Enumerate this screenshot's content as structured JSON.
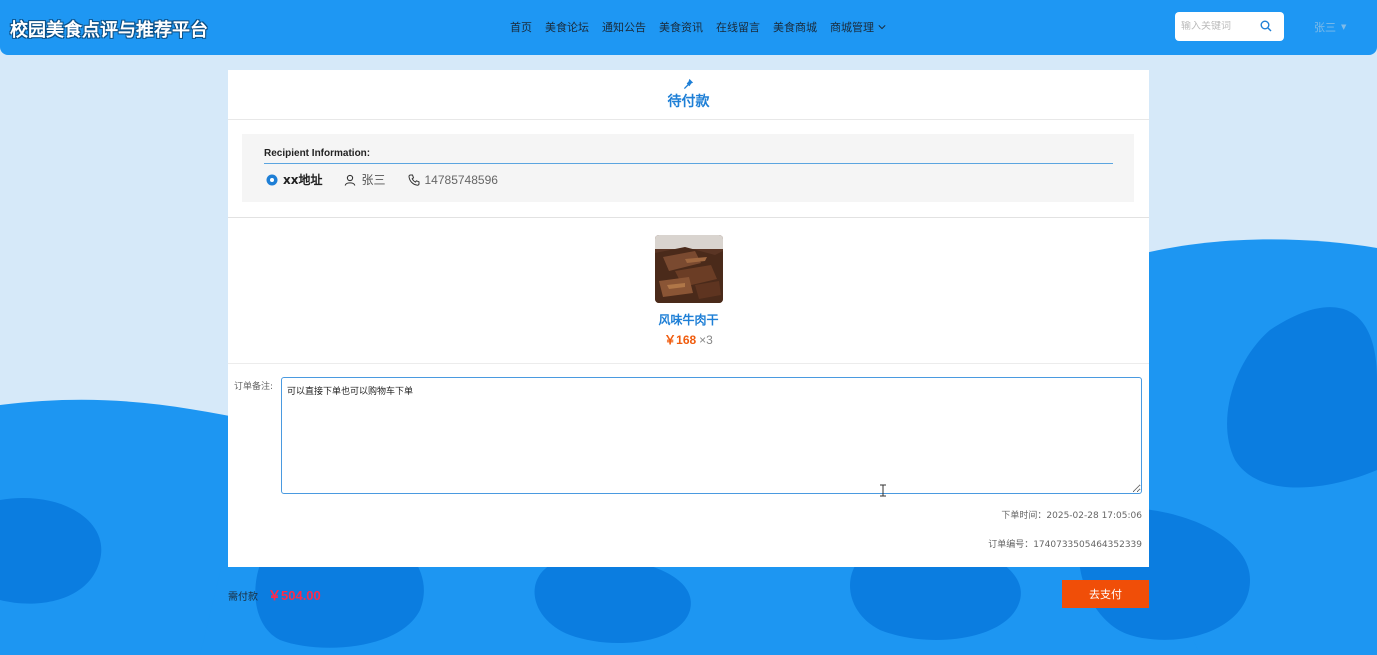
{
  "header": {
    "logo": "校园美食点评与推荐平台",
    "nav": [
      "首页",
      "美食论坛",
      "通知公告",
      "美食资讯",
      "在线留言",
      "美食商城"
    ],
    "nav_dropdown": "商城管理",
    "search_placeholder": "输入关键词",
    "user": "张三"
  },
  "order": {
    "status": "待付款",
    "recipient_label": "Recipient Information:",
    "address": "xx地址",
    "name": "张三",
    "phone": "14785748596",
    "product": {
      "name": "风味牛肉干",
      "price": "￥168",
      "quantity": "×3"
    },
    "remark_label": "订单备注:",
    "remark_value": "可以直接下单也可以购物车下单",
    "order_time": "下单时间：2025-02-28 17:05:06",
    "order_no": "订单编号：1740733505464352339"
  },
  "payment": {
    "label": "需付款",
    "amount": "￥504.00",
    "button": "去支付"
  },
  "colors": {
    "header_bg": "#1e97f3",
    "accent": "#1e7fd6",
    "price": "#f05c0e",
    "pay_button": "#f04e08",
    "amount": "#ff2a4a"
  }
}
